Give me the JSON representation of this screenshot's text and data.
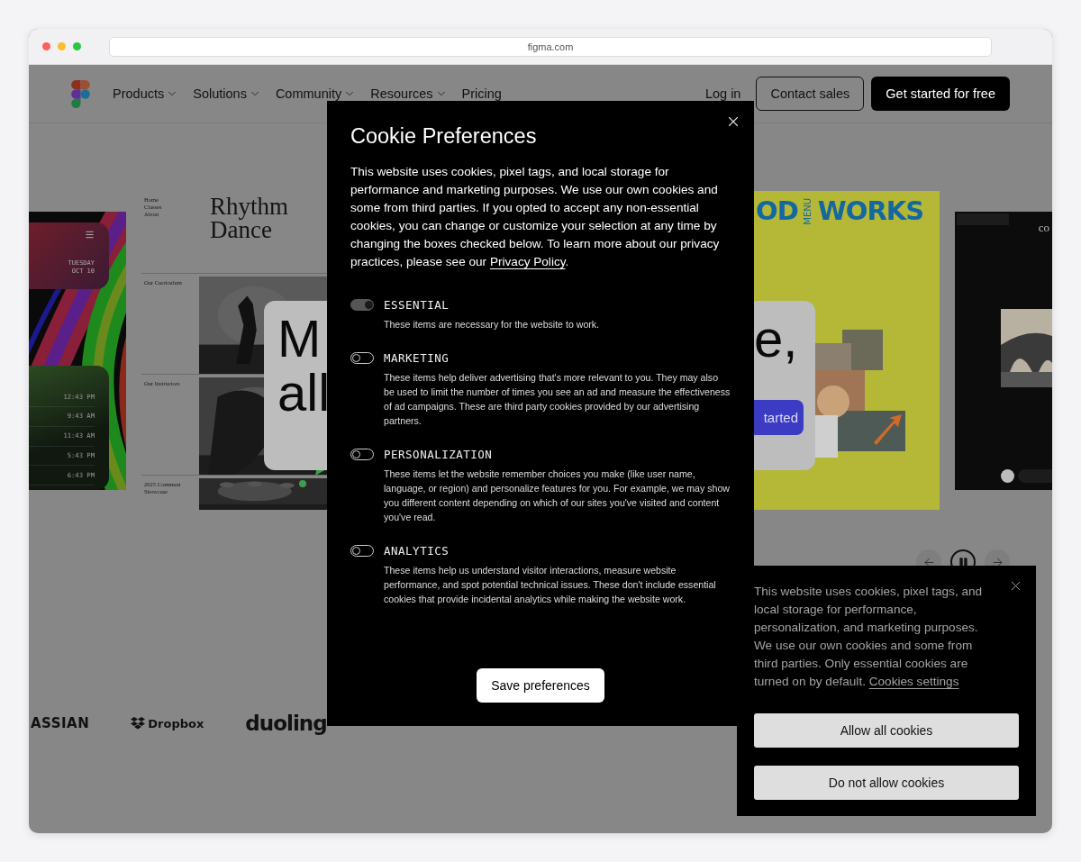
{
  "browser": {
    "url": "figma.com"
  },
  "nav": {
    "items": [
      {
        "label": "Products",
        "dropdown": true
      },
      {
        "label": "Solutions",
        "dropdown": true
      },
      {
        "label": "Community",
        "dropdown": true
      },
      {
        "label": "Resources",
        "dropdown": true
      },
      {
        "label": "Pricing",
        "dropdown": false
      }
    ],
    "login": "Log in",
    "contact": "Contact sales",
    "cta": "Get started for free"
  },
  "carousel": {
    "cards": [
      {
        "kind": "clock",
        "day": "TUESDAY",
        "date": "OCT 10",
        "times": [
          "12:43 PM",
          "9:43 AM",
          "11:43 AM",
          "5:43 PM",
          "6:43 PM"
        ]
      },
      {
        "kind": "dance",
        "links": [
          "Home",
          "Classes",
          "About"
        ],
        "title_lines": [
          "Rhythm",
          "Dance"
        ],
        "sections": [
          {
            "lines": [
              "Our Curriculum"
            ]
          },
          {
            "lines": [
              "Our Instructors"
            ]
          },
          {
            "lines": [
              "2025 Communi",
              "Showcase"
            ]
          }
        ]
      },
      {
        "kind": "menu",
        "title_left": "OD",
        "side": "MENU",
        "title_right": "WORKS"
      },
      {
        "kind": "archive",
        "title": "co"
      }
    ],
    "hero": {
      "left_lines": [
        "M",
        "all"
      ],
      "right_text": "e,",
      "button": "tarted"
    }
  },
  "logos": [
    {
      "kind": "wordmark",
      "name": "ASSIAN"
    },
    {
      "kind": "icon",
      "name": "Dropbox"
    },
    {
      "kind": "round",
      "name": "duoling"
    }
  ],
  "modal": {
    "title": "Cookie Preferences",
    "intro": "This website uses cookies, pixel tags, and local storage for performance and marketing purposes. We use our own cookies and some from third parties. If you opted to accept any non-essential cookies, you can change or customize your selection at any time by changing the boxes checked below. To learn more about our privacy practices, please see our ",
    "link": "Privacy Policy",
    "intro_end": ".",
    "sections": [
      {
        "label": "ESSENTIAL",
        "on": true,
        "text": "These items are necessary for the website to work."
      },
      {
        "label": "MARKETING",
        "on": false,
        "text": "These items help deliver advertising that's more relevant to you. They may also be used to limit the number of times you see an ad and measure the effectiveness of ad campaigns. These are third party cookies provided by our advertising partners."
      },
      {
        "label": "PERSONALIZATION",
        "on": false,
        "text": "These items let the website remember choices you make (like user name, language, or region) and personalize features for you. For example, we may show you different content depending on which of our sites you've visited and content you've read."
      },
      {
        "label": "ANALYTICS",
        "on": false,
        "text": "These items help us understand visitor interactions, measure website performance, and spot potential technical issues. These don't include essential cookies that provide incidental analytics while making the website work."
      }
    ],
    "button": "Save preferences"
  },
  "banner": {
    "text": "This website uses cookies, pixel tags, and local storage for performance, personalization, and marketing purposes. We use our own cookies and some from third parties. Only essential cookies are turned on by default. ",
    "link": "Cookies settings",
    "buttons": [
      "Allow all cookies",
      "Do not allow cookies"
    ]
  }
}
